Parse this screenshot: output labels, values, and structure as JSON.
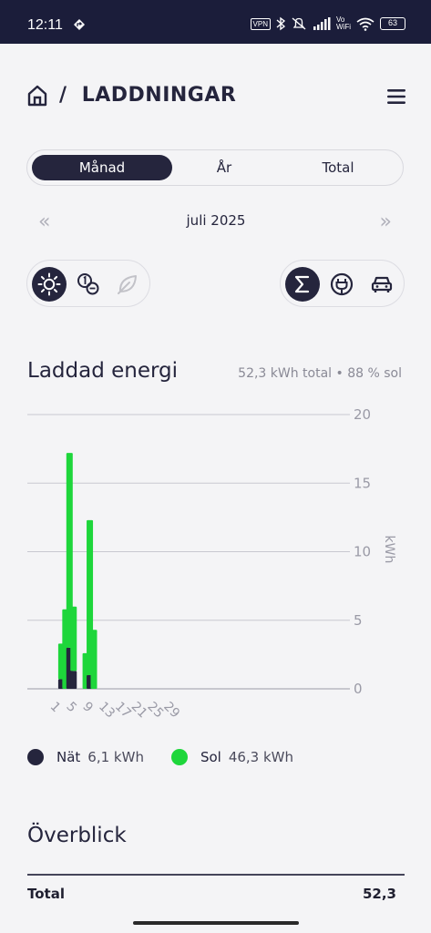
{
  "status_bar": {
    "time": "12:11",
    "vpn": "VPN",
    "wifi_label_top": "Vo",
    "wifi_label_bottom": "WiFi",
    "battery": "63"
  },
  "header": {
    "separator": "/",
    "title": "LADDNINGAR",
    "icons": [
      "home-icon",
      "menu-icon"
    ]
  },
  "period_tabs": {
    "items": [
      "Månad",
      "År",
      "Total"
    ],
    "selected": "Månad"
  },
  "month_nav": {
    "prev": "«",
    "label": "juli 2025",
    "next": "»"
  },
  "source_filters": {
    "icons": [
      "sun-icon",
      "grid-meter-icon",
      "leaf-icon"
    ],
    "selected": "sun-icon"
  },
  "view_filters": {
    "icons": [
      "sum-icon",
      "charger-icon",
      "car-icon"
    ],
    "selected": "sum-icon"
  },
  "energy": {
    "title": "Laddad energi",
    "summary": "52,3 kWh total • 88 % sol"
  },
  "chart_data": {
    "type": "bar",
    "stacked": true,
    "x": [
      1,
      2,
      3,
      4,
      5,
      6,
      7,
      8,
      9,
      10,
      11,
      12,
      13,
      14,
      15,
      16,
      17,
      18,
      19,
      20,
      21,
      22,
      23,
      24,
      25,
      26,
      27,
      28,
      29,
      30,
      31
    ],
    "x_tick_labels": [
      "1",
      "5",
      "9",
      "13",
      "17",
      "21",
      "25",
      "29"
    ],
    "series": [
      {
        "name": "Nät",
        "color": "#25253d",
        "values": [
          0,
          0,
          0.7,
          0,
          3.0,
          1.3,
          0,
          0,
          0,
          1.0,
          0,
          0,
          0,
          0,
          0,
          0,
          0,
          0,
          0,
          0,
          0,
          0,
          0,
          0,
          0,
          0,
          0,
          0,
          0,
          0,
          0
        ]
      },
      {
        "name": "Sol",
        "color": "#1ed63b",
        "values": [
          0,
          0,
          2.6,
          5.8,
          14.2,
          4.7,
          0,
          0,
          2.6,
          11.3,
          4.3,
          0,
          0,
          0,
          0,
          0,
          0,
          0,
          0,
          0,
          0,
          0,
          0,
          0,
          0,
          0,
          0,
          0,
          0,
          0,
          0
        ]
      }
    ],
    "ylim": [
      0,
      20
    ],
    "y_ticks": [
      "0",
      "5",
      "10",
      "15",
      "20"
    ],
    "ylabel": "kWh",
    "grid": true,
    "legend_placement": "bottom-left"
  },
  "legend": [
    {
      "name": "Nät",
      "value": "6,1 kWh",
      "color": "#25253d"
    },
    {
      "name": "Sol",
      "value": "46,3 kWh",
      "color": "#1ed63b"
    }
  ],
  "overview": {
    "title": "Överblick",
    "rows": [
      {
        "label": "Total",
        "value": "52,3"
      }
    ]
  }
}
